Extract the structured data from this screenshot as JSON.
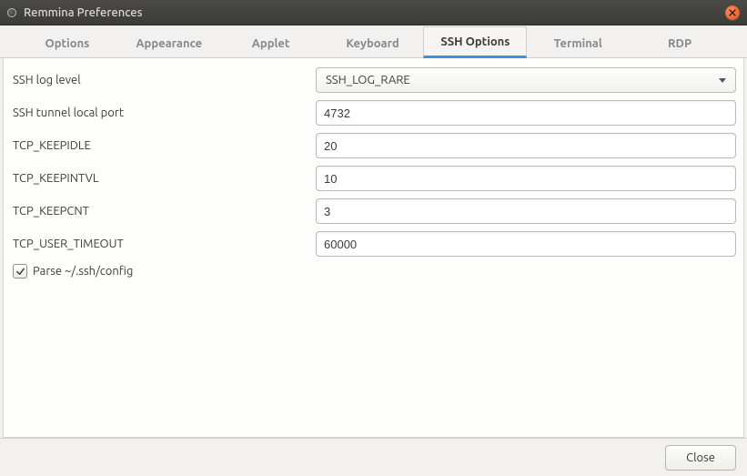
{
  "window": {
    "title": "Remmina Preferences"
  },
  "tabs": [
    {
      "label": "Options"
    },
    {
      "label": "Appearance"
    },
    {
      "label": "Applet"
    },
    {
      "label": "Keyboard"
    },
    {
      "label": "SSH Options"
    },
    {
      "label": "Terminal"
    },
    {
      "label": "RDP"
    }
  ],
  "active_tab": "SSH Options",
  "ssh": {
    "log_level_label": "SSH log level",
    "log_level_value": "SSH_LOG_RARE",
    "tunnel_port_label": "SSH tunnel local port",
    "tunnel_port_value": "4732",
    "keepidle_label": "TCP_KEEPIDLE",
    "keepidle_value": "20",
    "keepintvl_label": "TCP_KEEPINTVL",
    "keepintvl_value": "10",
    "keepcnt_label": "TCP_KEEPCNT",
    "keepcnt_value": "3",
    "user_timeout_label": "TCP_USER_TIMEOUT",
    "user_timeout_value": "60000",
    "parse_config_label": "Parse ~/.ssh/config",
    "parse_config_checked": true
  },
  "footer": {
    "close_label": "Close"
  }
}
